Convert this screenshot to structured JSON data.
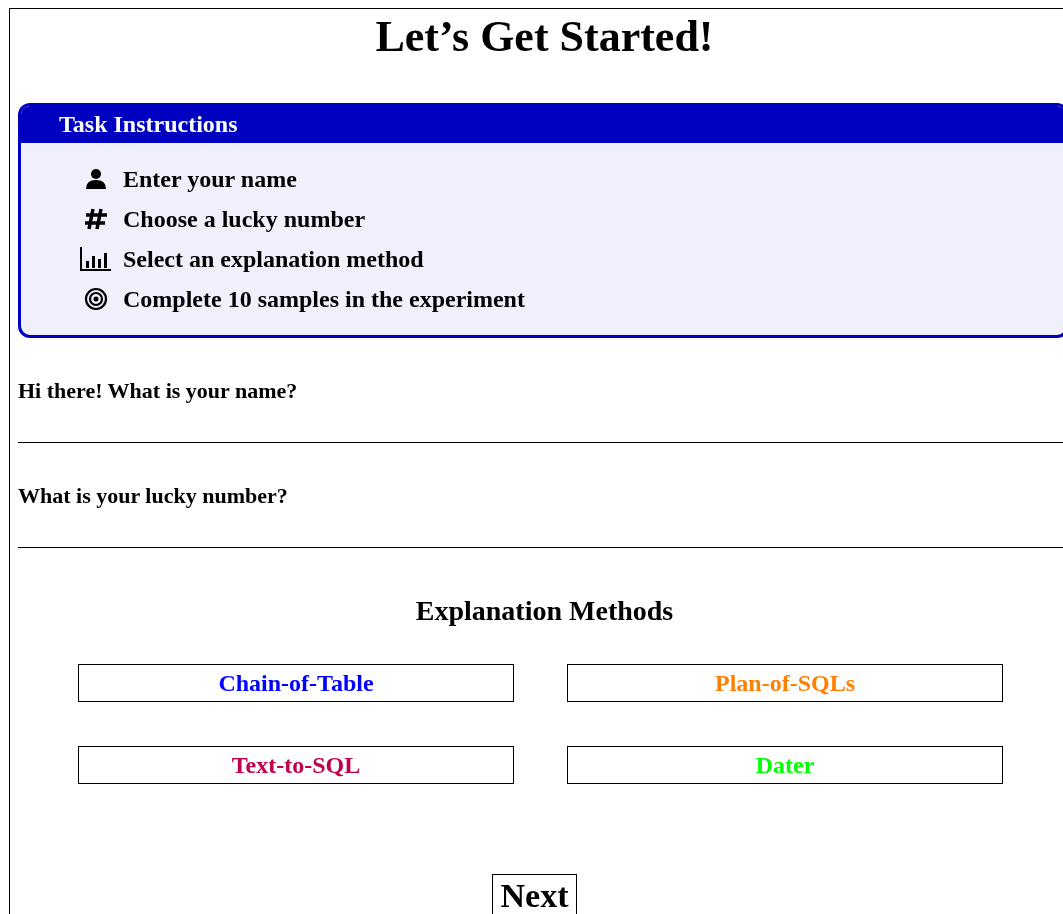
{
  "title": "Let’s Get Started!",
  "instructions": {
    "title": "Task Instructions",
    "items": [
      {
        "kind": "person",
        "text": "Enter your name"
      },
      {
        "kind": "hash",
        "text": "Choose a lucky number"
      },
      {
        "kind": "chart",
        "text": "Select an explanation method"
      },
      {
        "kind": "target",
        "text": "Complete 10 samples in the experiment"
      }
    ]
  },
  "questions": [
    {
      "label": "Hi there! What is your name?"
    },
    {
      "label": "What is your lucky number?"
    }
  ],
  "methods": {
    "title": "Explanation Methods",
    "options": [
      {
        "label": "Chain-of-Table",
        "color": "#0000ff"
      },
      {
        "label": "Plan-of-SQLs",
        "color": "#ff8000"
      },
      {
        "label": "Text-to-SQL",
        "color": "#c0004f"
      },
      {
        "label": "Dater",
        "color": "#00ff00"
      }
    ]
  },
  "next_button": "Next"
}
